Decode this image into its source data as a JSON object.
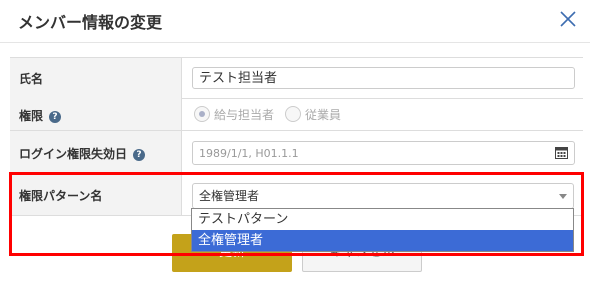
{
  "dialog": {
    "title": "メンバー情報の変更"
  },
  "form": {
    "name": {
      "label": "氏名",
      "value": "テスト担当者"
    },
    "authority": {
      "label": "権限",
      "options": [
        {
          "label": "給与担当者",
          "checked": true
        },
        {
          "label": "従業員",
          "checked": false
        }
      ]
    },
    "login_expiry": {
      "label": "ログイン権限失効日",
      "placeholder": "1989/1/1, H01.1.1"
    },
    "pattern": {
      "label": "権限パターン名",
      "selected": "全権管理者",
      "options": [
        "テストパターン",
        "全権管理者"
      ]
    }
  },
  "buttons": {
    "update": "更新",
    "cancel": "キャンセル"
  },
  "icons": {
    "help": "question-circle-icon",
    "close": "close-x-icon",
    "calendar": "calendar-icon",
    "caret": "caret-down-icon"
  },
  "colors": {
    "update_button": "#c4a21a",
    "selected_option": "#3c6bd6",
    "highlight_box": "#ff0000"
  }
}
